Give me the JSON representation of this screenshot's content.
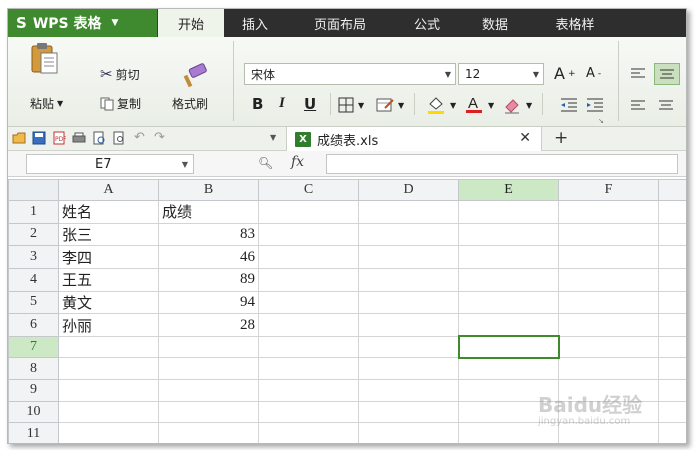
{
  "app": {
    "logo": "S",
    "name": "WPS 表格"
  },
  "menu_tabs": [
    "开始",
    "插入",
    "页面布局",
    "公式",
    "数据",
    "表格样"
  ],
  "ribbon": {
    "paste": "粘贴",
    "cut": "剪切",
    "copy": "复制",
    "format_painter": "格式刷",
    "font_name": "宋体",
    "font_size": "12",
    "bold": "B",
    "italic": "I",
    "underline": "U",
    "grow_font": "A",
    "shrink_font": "A"
  },
  "document": {
    "tab_title": "成绩表.xls",
    "icon_label": "X"
  },
  "formula_bar": {
    "cell_ref": "E7",
    "fx_label": "fx"
  },
  "sheet": {
    "columns": [
      "A",
      "B",
      "C",
      "D",
      "E",
      "F"
    ],
    "row_numbers": [
      "1",
      "2",
      "3",
      "4",
      "5",
      "6",
      "7",
      "8",
      "9",
      "10",
      "11"
    ],
    "selected_cell": "E7",
    "rows": [
      [
        "姓名",
        "成绩"
      ],
      [
        "张三",
        "83"
      ],
      [
        "李四",
        "46"
      ],
      [
        "王五",
        "89"
      ],
      [
        "黄文",
        "94"
      ],
      [
        "孙丽",
        "28"
      ],
      [],
      [],
      [],
      [],
      []
    ]
  },
  "watermark": {
    "brand": "Baidu经验",
    "url": "jingyan.baidu.com"
  },
  "colors": {
    "accent": "#3e8b2c",
    "menubar": "#2e2e2e"
  }
}
